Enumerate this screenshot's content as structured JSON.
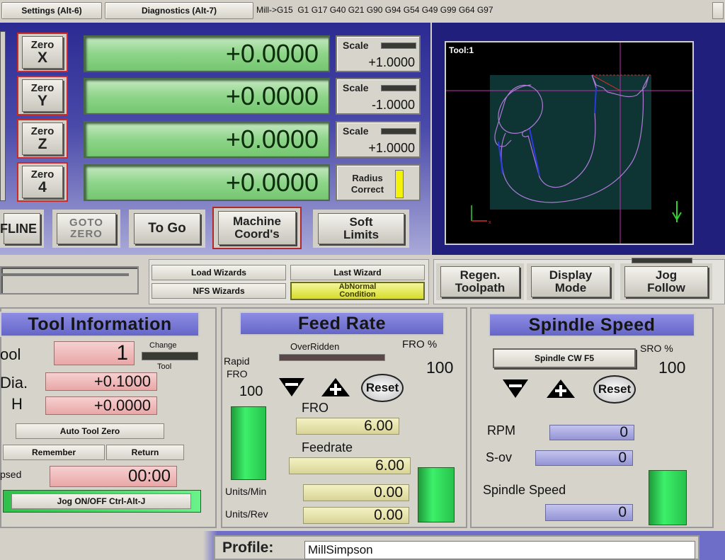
{
  "topbar": {
    "settings_tab": "Settings (Alt-6)",
    "diagnostics_tab": "Diagnostics (Alt-7)",
    "gcode_status": "Mill->G15  G1 G17 G40 G21 G90 G94 G54 G49 G99 G64 G97"
  },
  "dro": {
    "zero_label": "Zero",
    "axes": [
      {
        "axis": "X",
        "value": "+0.0000",
        "scale_label": "Scale",
        "scale_value": "+1.0000"
      },
      {
        "axis": "Y",
        "value": "+0.0000",
        "scale_label": "Scale",
        "scale_value": "-1.0000"
      },
      {
        "axis": "Z",
        "value": "+0.0000",
        "scale_label": "Scale",
        "scale_value": "+1.0000"
      },
      {
        "axis": "4",
        "value": "+0.0000"
      }
    ],
    "radius_correct": "Radius Correct",
    "buttons": {
      "offline": "FLINE",
      "goto_zero_1": "GOTO",
      "goto_zero_2": "ZERO",
      "to_go": "To Go",
      "machine_coords_1": "Machine",
      "machine_coords_2": "Coord's",
      "soft_limits_1": "Soft",
      "soft_limits_2": "Limits"
    }
  },
  "toolpath": {
    "tool_label": "Tool:1",
    "regen_1": "Regen.",
    "regen_2": "Toolpath",
    "display_1": "Display",
    "display_2": "Mode",
    "jog_1": "Jog",
    "jog_2": "Follow"
  },
  "wizards": {
    "load": "Load Wizards",
    "last": "Last Wizard",
    "nfs": "NFS Wizards",
    "abnormal_1": "AbNormal",
    "abnormal_2": "Condition"
  },
  "tool_info": {
    "title": "Tool Information",
    "tool_label": "ool",
    "tool_value": "1",
    "change_label": "Change",
    "tool_small": "Tool",
    "dia_label": "Dia.",
    "dia_value": "+0.1000",
    "h_label": "H",
    "h_value": "+0.0000",
    "auto_tool_zero": "Auto Tool Zero",
    "remember": "Remember",
    "return": "Return",
    "elapsed_label": "psed",
    "elapsed_value": "00:00",
    "jog_toggle": "Jog ON/OFF Ctrl-Alt-J"
  },
  "feed": {
    "title": "Feed Rate",
    "overridden": "OverRidden",
    "fro_pct_label": "FRO %",
    "fro_pct_value": "100",
    "rapid_label_1": "Rapid",
    "rapid_label_2": "FRO",
    "rapid_value": "100",
    "reset": "Reset",
    "fro_label": "FRO",
    "fro_value": "6.00",
    "feedrate_label": "Feedrate",
    "feedrate_value": "6.00",
    "units_min_label": "Units/Min",
    "units_min_value": "0.00",
    "units_rev_label": "Units/Rev",
    "units_rev_value": "0.00"
  },
  "spindle": {
    "title": "Spindle Speed",
    "cw_button": "Spindle CW F5",
    "sro_label": "SRO %",
    "sro_value": "100",
    "reset": "Reset",
    "rpm_label": "RPM",
    "rpm_value": "0",
    "sov_label": "S-ov",
    "sov_value": "0",
    "speed_label": "Spindle Speed",
    "speed_value": "0"
  },
  "profile": {
    "label": "Profile:",
    "value": "MillSimpson"
  }
}
